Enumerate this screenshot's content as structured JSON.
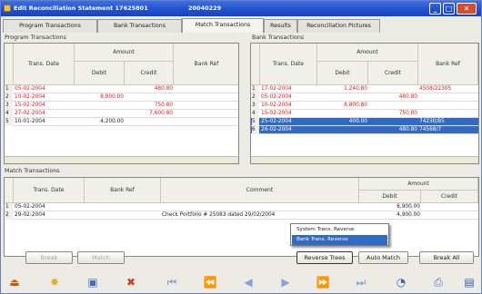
{
  "window": {
    "title": "Edit Reconciliation Statement 17625801",
    "id": "20040229",
    "minimize": "_",
    "maximize": "□",
    "close": "✕"
  },
  "tabs": [
    "Program Transactions",
    "Bank Transactions",
    "Match Transactions",
    "Results",
    "Reconciliation Pictures"
  ],
  "program": {
    "section": "Program Transactions",
    "h_date": "Trans. Date",
    "h_amount": "Amount",
    "h_debit": "Debit",
    "h_credit": "Credit",
    "h_ref": "Bank Ref",
    "rows": [
      {
        "n": "1",
        "date": "05-02-2004",
        "debit": "",
        "credit": "480.80",
        "ref": ""
      },
      {
        "n": "2",
        "date": "10-02-2004",
        "debit": "8,800.00",
        "credit": "",
        "ref": ""
      },
      {
        "n": "3",
        "date": "15-02-2004",
        "debit": "",
        "credit": "750.80",
        "ref": ""
      },
      {
        "n": "4",
        "date": "27-02-2004",
        "debit": "",
        "credit": "7,600.80",
        "ref": ""
      },
      {
        "n": "5",
        "date": "10-01-2004",
        "debit": "4,200.00",
        "credit": "",
        "ref": ""
      }
    ]
  },
  "bank": {
    "section": "Bank Transactions",
    "h_date": "Trans. Date",
    "h_amount": "Amount",
    "h_debit": "Debit",
    "h_credit": "Credit",
    "h_ref": "Bank Ref",
    "rows": [
      {
        "n": "1",
        "date": "17-02-2004",
        "debit": "1,240.80",
        "credit": "",
        "ref": "4508/22305"
      },
      {
        "n": "2",
        "date": "05-02-2004",
        "debit": "",
        "credit": "480.80",
        "ref": ""
      },
      {
        "n": "3",
        "date": "10-02-2004",
        "debit": "8,800.80",
        "credit": "",
        "ref": ""
      },
      {
        "n": "4",
        "date": "15-02-2004",
        "debit": "",
        "credit": "750.80",
        "ref": ""
      },
      {
        "n": "5",
        "date": "25-02-2004",
        "debit": "400.00",
        "credit": "",
        "ref": "74230/85"
      },
      {
        "n": "6",
        "date": "26-02-2004",
        "debit": "",
        "credit": "480.80",
        "ref": "74568/7"
      }
    ]
  },
  "match": {
    "section": "Match Transactions",
    "h_date": "Trans. Date",
    "h_ref": "Bank Ref",
    "h_comment": "Comment",
    "h_amount": "Amount",
    "h_debit": "Debit",
    "h_credit": "Credit",
    "rows": [
      {
        "n": "1",
        "date": "05-02-2004",
        "ref": "",
        "comment": "",
        "debit": "6,900.00",
        "credit": ""
      },
      {
        "n": "2",
        "date": "29-02-2004",
        "ref": "",
        "comment": "Check Portfolio # 25083 dated 29/02/2004",
        "debit": "4,900.00",
        "credit": ""
      }
    ]
  },
  "context_menu": {
    "items": [
      "System Trans. Reverse",
      "Bank Trans. Reverse"
    ]
  },
  "buttons": {
    "break": "Break",
    "match": "Match",
    "reverse": "Reverse Trees",
    "auto": "Auto Match",
    "break_all": "Break All"
  },
  "colors": {
    "red": "#e01818",
    "selection": "#316ac5",
    "title": "#1e4fd0"
  },
  "toolbar": [
    "exit-icon",
    "new-icon",
    "open-icon",
    "delete-icon",
    "first-icon",
    "prev-page-icon",
    "prev-icon",
    "next-icon",
    "next-page-icon",
    "last-icon",
    "search-icon",
    "print-icon",
    "save-icon"
  ]
}
